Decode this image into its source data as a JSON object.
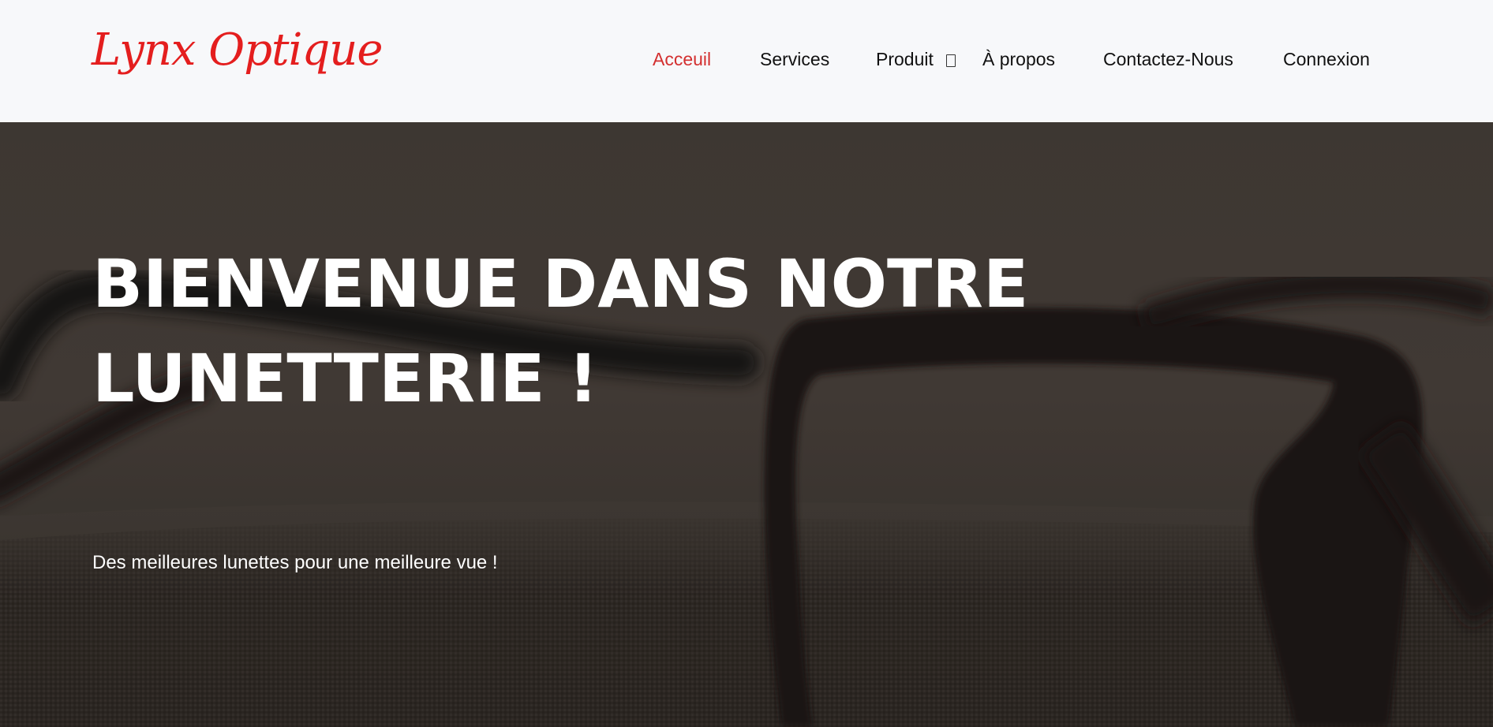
{
  "brand": {
    "name": "Lynx Optique",
    "color": "#e41e1e"
  },
  "nav": {
    "active_color": "#d32f2f",
    "items": [
      {
        "label": "Acceuil",
        "active": true
      },
      {
        "label": "Services",
        "active": false
      },
      {
        "label": "Produit",
        "active": false,
        "icon": "dropdown-icon"
      },
      {
        "label": "À propos",
        "active": false
      },
      {
        "label": "Contactez-Nous",
        "active": false
      },
      {
        "label": "Connexion",
        "active": false
      }
    ]
  },
  "hero": {
    "title": "BIENVENUE DANS NOTRE LUNETTERIE !",
    "subtitle": "Des meilleures lunettes pour une meilleure vue !",
    "background": "eyeglasses-on-fabric-image"
  }
}
